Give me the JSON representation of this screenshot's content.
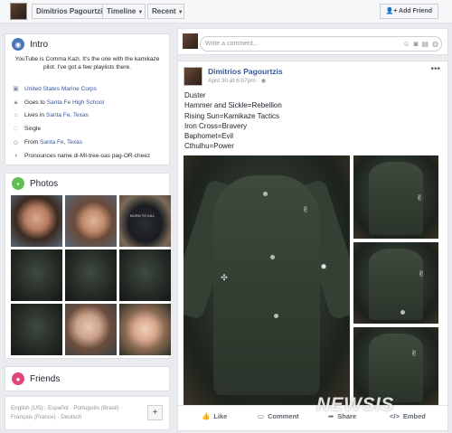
{
  "topbar": {
    "profile_name": "Dimitrios Pagourtzis",
    "timeline_label": "Timeline",
    "recent_label": "Recent",
    "add_friend_label": "Add Friend"
  },
  "intro": {
    "title": "Intro",
    "bio": "YouTube is Comma Kazi. It's the one with the kamikaze pilot. I've got a few playlists there.",
    "items": [
      {
        "icon": "briefcase-icon",
        "prefix": "",
        "link": "United States Marine Corps"
      },
      {
        "icon": "graduation-cap-icon",
        "prefix": "Goes to ",
        "link": "Santa Fe High School"
      },
      {
        "icon": "home-icon",
        "prefix": "Lives in ",
        "link": "Santa Fe, Texas"
      },
      {
        "icon": "heart-icon",
        "prefix": "Single",
        "link": ""
      },
      {
        "icon": "location-pin-icon",
        "prefix": "From ",
        "link": "Santa Fe, Texas"
      },
      {
        "icon": "speech-bubble-icon",
        "prefix": "Pronounces name di-MI-tree-oas pag-OR-cheez",
        "link": ""
      }
    ]
  },
  "photos": {
    "title": "Photos",
    "shirt_text": "BORN TO KILL"
  },
  "friends": {
    "title": "Friends"
  },
  "footer": {
    "lang_line1": "English (US) · Español · Português (Brasil) ·",
    "lang_line2": "Français (France) · Deutsch",
    "plus": "+"
  },
  "composer": {
    "placeholder": "Write a comment..."
  },
  "post": {
    "author": "Dimitrios Pagourtzis",
    "date": "April 30 at 6:07pm · ",
    "lines": [
      "Duster",
      "Hammer and Sickle=Rebellion",
      "Rising Sun=Kamikaze Tactics",
      "Iron Cross=Bravery",
      "Baphomet=Evil",
      "Cthulhu=Power"
    ],
    "actions": {
      "like": "Like",
      "comment": "Comment",
      "share": "Share",
      "embed": "Embed"
    }
  },
  "watermark": "NEWSIS",
  "colors": {
    "link": "#365899",
    "background": "#e9ebee",
    "intro_icon": "#4a76b8",
    "photos_icon": "#63be55",
    "friends_icon": "#e0457b"
  }
}
